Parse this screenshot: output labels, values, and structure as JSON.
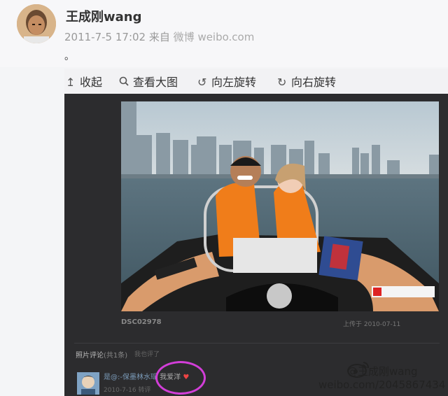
{
  "post": {
    "username": "王成刚wang",
    "time": "2011-7-5 17:02",
    "source_prefix": "来自",
    "source": "微博 weibo.com",
    "text": "。"
  },
  "toolbar": {
    "collapse": "收起",
    "view_large": "查看大图",
    "rotate_left": "向左旋转",
    "rotate_right": "向右旋转"
  },
  "photo_viewer": {
    "caption": "DSC02978",
    "uploader": "上传于 2010-07-11",
    "comments_header": "照片评论",
    "comments_count": "(共1条)",
    "comments_closed": "我也评了",
    "comment": {
      "author": "是@:-保墨林水瑶",
      "body": "我爱洋",
      "date": "2010-7-16 转评"
    }
  },
  "watermark": {
    "handle": "@王成刚wang",
    "url": "weibo.com/2045867434"
  },
  "colors": {
    "viewer_bg": "#2c2c2e",
    "highlight_circle": "#d23ed8"
  }
}
